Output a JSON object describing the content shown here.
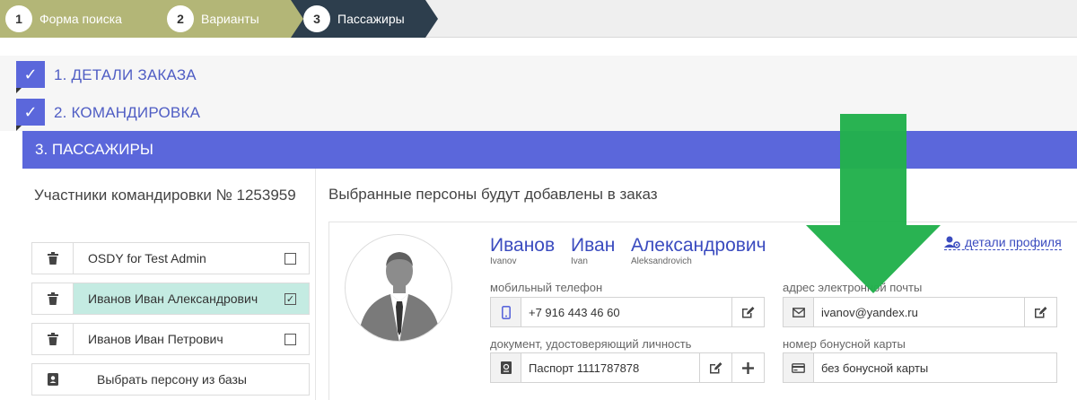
{
  "wizard": {
    "steps": [
      {
        "num": "1",
        "label": "Форма поиска"
      },
      {
        "num": "2",
        "label": "Варианты"
      },
      {
        "num": "3",
        "label": "Пассажиры"
      }
    ]
  },
  "accordion": {
    "order_details": "1. ДЕТАЛИ ЗАКАЗА",
    "business_trip": "2. КОМАНДИРОВКА",
    "passengers": "3. ПАССАЖИРЫ"
  },
  "participants": {
    "title": "Участники командировки № 1253959",
    "rows": [
      {
        "name": "OSDY for Test Admin",
        "checked": false
      },
      {
        "name": "Иванов Иван Александрович",
        "checked": true
      },
      {
        "name": "Иванов Иван Петрович",
        "checked": false
      }
    ],
    "pick_from_db": "Выбрать персону из базы"
  },
  "selected": {
    "title": "Выбранные персоны будут добавлены в заказ",
    "last_name": "Иванов",
    "first_name": "Иван",
    "middle_name": "Александрович",
    "last_name_lat": "Ivanov",
    "first_name_lat": "Ivan",
    "middle_name_lat": "Aleksandrovich",
    "profile_link": "детали профиля",
    "mobile_label": "мобильный телефон",
    "mobile_value": "+7 916 443 46 60",
    "email_label": "адрес электронной почты",
    "email_value": "ivanov@yandex.ru",
    "document_label": "документ, удостоверяющий личность",
    "document_value": "Паспорт 1111787878",
    "bonus_label": "номер бонусной карты",
    "bonus_value": "без бонусной карты"
  },
  "colors": {
    "accent": "#5b67db",
    "wizard_done": "#b3b677",
    "wizard_active": "#2d3e4d",
    "selected_row": "#c4ebe2",
    "annotation_arrow": "#22b14c"
  },
  "icons": {
    "check": "check-icon",
    "trash": "trash-icon",
    "contact": "contact-card-icon",
    "phone": "phone-icon",
    "envelope": "envelope-icon",
    "passport": "passport-icon",
    "credit_card": "credit-card-icon",
    "edit": "edit-icon",
    "plus": "plus-icon",
    "user_settings": "user-settings-icon",
    "arrow": "down-arrow-annotation"
  }
}
